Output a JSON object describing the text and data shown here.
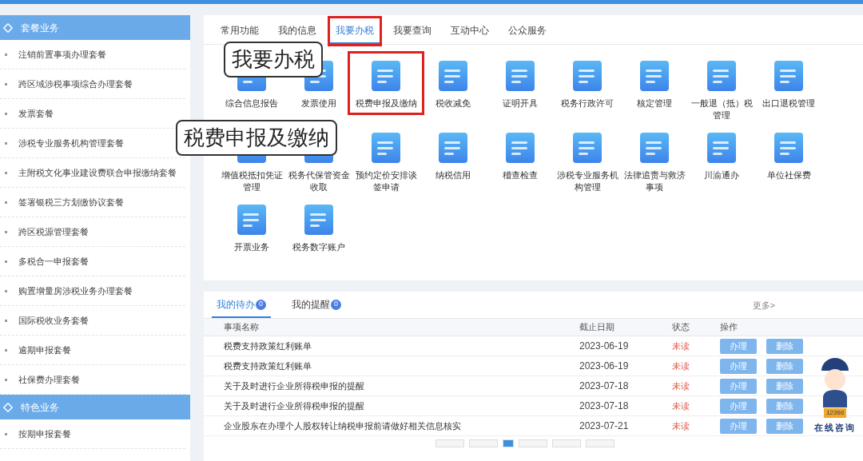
{
  "sidebar": {
    "sections": [
      {
        "title": "套餐业务",
        "items": [
          "注销前置事项办理套餐",
          "跨区域涉税事项综合办理套餐",
          "发票套餐",
          "涉税专业服务机构管理套餐",
          "主附税文化事业建设费联合申报缴纳套餐",
          "签署银税三方划缴协议套餐",
          "跨区税源管理套餐",
          "多税合一申报套餐",
          "购置增量房涉税业务办理套餐",
          "国际税收业务套餐",
          "逾期申报套餐",
          "社保费办理套餐"
        ]
      },
      {
        "title": "特色业务",
        "items": [
          "按期申报套餐"
        ]
      }
    ]
  },
  "tabs": [
    {
      "label": "常用功能",
      "selected": false
    },
    {
      "label": "我的信息",
      "selected": false
    },
    {
      "label": "我要办税",
      "selected": true
    },
    {
      "label": "我要查询",
      "selected": false
    },
    {
      "label": "互动中心",
      "selected": false
    },
    {
      "label": "公众服务",
      "selected": false
    }
  ],
  "functions": [
    {
      "label": "综合信息报告",
      "highlighted": false
    },
    {
      "label": "发票使用",
      "highlighted": false
    },
    {
      "label": "税费申报及缴纳",
      "highlighted": true
    },
    {
      "label": "税收减免",
      "highlighted": false
    },
    {
      "label": "证明开具",
      "highlighted": false
    },
    {
      "label": "税务行政许可",
      "highlighted": false
    },
    {
      "label": "核定管理",
      "highlighted": false
    },
    {
      "label": "一般退（抵）税管理",
      "highlighted": false
    },
    {
      "label": "出口退税管理",
      "highlighted": false
    },
    {
      "label": "增值税抵扣凭证管理",
      "highlighted": false
    },
    {
      "label": "税务代保管资金收取",
      "highlighted": false
    },
    {
      "label": "预约定价安排谈签申请",
      "highlighted": false
    },
    {
      "label": "纳税信用",
      "highlighted": false
    },
    {
      "label": "稽查检查",
      "highlighted": false
    },
    {
      "label": "涉税专业服务机构管理",
      "highlighted": false
    },
    {
      "label": "法律追责与救济事项",
      "highlighted": false
    },
    {
      "label": "川渝通办",
      "highlighted": false
    },
    {
      "label": "单位社保费",
      "highlighted": false
    },
    {
      "label": "开票业务",
      "highlighted": false
    },
    {
      "label": "税务数字账户",
      "highlighted": false
    }
  ],
  "callouts": [
    "我要办税",
    "税费申报及缴纳"
  ],
  "todo": {
    "tabs": [
      {
        "label": "我的待办",
        "badge": "0",
        "selected": true
      },
      {
        "label": "我的提醒",
        "badge": "0",
        "selected": false
      }
    ],
    "more": "更多>",
    "columns": [
      "事项名称",
      "截止日期",
      "状态",
      "操作"
    ],
    "rows": [
      {
        "name": "税费支持政策红利账单",
        "date": "2023-06-19",
        "status": "未读",
        "actions": [
          "办理",
          "删除"
        ]
      },
      {
        "name": "税费支持政策红利账单",
        "date": "2023-06-19",
        "status": "未读",
        "actions": [
          "办理",
          "删除"
        ]
      },
      {
        "name": "关于及时进行企业所得税申报的提醒",
        "date": "2023-07-18",
        "status": "未读",
        "actions": [
          "办理",
          "删除"
        ]
      },
      {
        "name": "关于及时进行企业所得税申报的提醒",
        "date": "2023-07-18",
        "status": "未读",
        "actions": [
          "办理",
          "删除"
        ]
      },
      {
        "name": "企业股东在办理个人股权转让纳税申报前请做好相关信息核实",
        "date": "2023-07-21",
        "status": "未读",
        "actions": [
          "办理",
          "删除"
        ]
      }
    ],
    "pagination": [
      {
        "selected": false
      },
      {
        "selected": false
      },
      {
        "selected": true
      },
      {
        "selected": false
      },
      {
        "selected": false
      },
      {
        "selected": false
      }
    ]
  },
  "assistant": {
    "badge": "12366",
    "label": "在线咨询"
  }
}
